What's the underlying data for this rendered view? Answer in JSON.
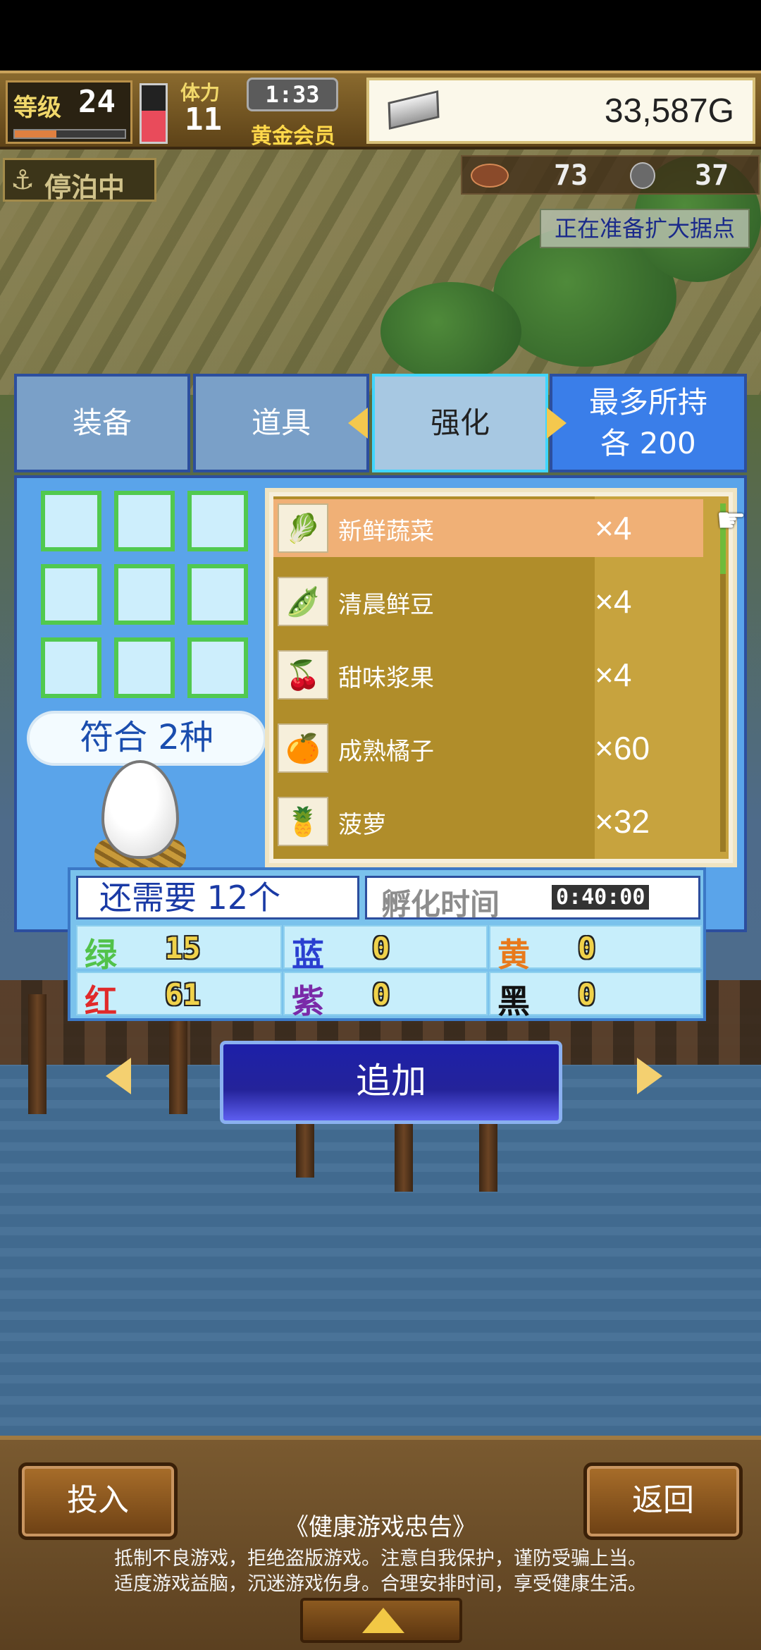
{
  "hud": {
    "level_label": "等级",
    "level": "24",
    "exp_fraction": 0.38,
    "stamina_label": "体力",
    "stamina": "11",
    "stamina_fraction": 0.55,
    "time": "1:33",
    "membership": "黄金会员",
    "money": "33,587G",
    "dock_status": "停泊中",
    "resource1": "73",
    "resource2": "37",
    "notice": "正在准备扩大据点"
  },
  "tabs": [
    {
      "label": "装备"
    },
    {
      "label": "道具"
    },
    {
      "label": "强化"
    },
    {
      "label_line1": "最多所持",
      "label_line2": "各 200"
    }
  ],
  "match_tag": "符合 2种",
  "items": [
    {
      "name": "新鲜蔬菜",
      "qty": "×4",
      "icon": "vegetable-icon",
      "selected": true
    },
    {
      "name": "清晨鲜豆",
      "qty": "×4",
      "icon": "bean-icon",
      "selected": false
    },
    {
      "name": "甜味浆果",
      "qty": "×4",
      "icon": "berry-icon",
      "selected": false
    },
    {
      "name": "成熟橘子",
      "qty": "×60",
      "icon": "orange-icon",
      "selected": false
    },
    {
      "name": "菠萝",
      "qty": "×32",
      "icon": "pineapple-icon",
      "selected": false
    }
  ],
  "needs": {
    "remaining": "还需要 12个",
    "hatch_label": "孵化时间",
    "hatch_time": "0:40:00",
    "colors": [
      {
        "label": "绿",
        "value": "15",
        "color": "#52c24a"
      },
      {
        "label": "蓝",
        "value": "0",
        "color": "#2a3fd0"
      },
      {
        "label": "黄",
        "value": "0",
        "color": "#e87a1c"
      },
      {
        "label": "红",
        "value": "61",
        "color": "#e02a2a"
      },
      {
        "label": "紫",
        "value": "0",
        "color": "#7a2aa8"
      },
      {
        "label": "黑",
        "value": "0",
        "color": "#111111"
      }
    ]
  },
  "add_button": "追加",
  "bottom": {
    "left_button": "投入",
    "right_button": "返回",
    "health_title": "《健康游戏忠告》",
    "health_line1": "抵制不良游戏，拒绝盗版游戏。注意自我保护，谨防受骗上当。",
    "health_line2": "适度游戏益脑，沉迷游戏伤身。合理安排时间，享受健康生活。"
  }
}
